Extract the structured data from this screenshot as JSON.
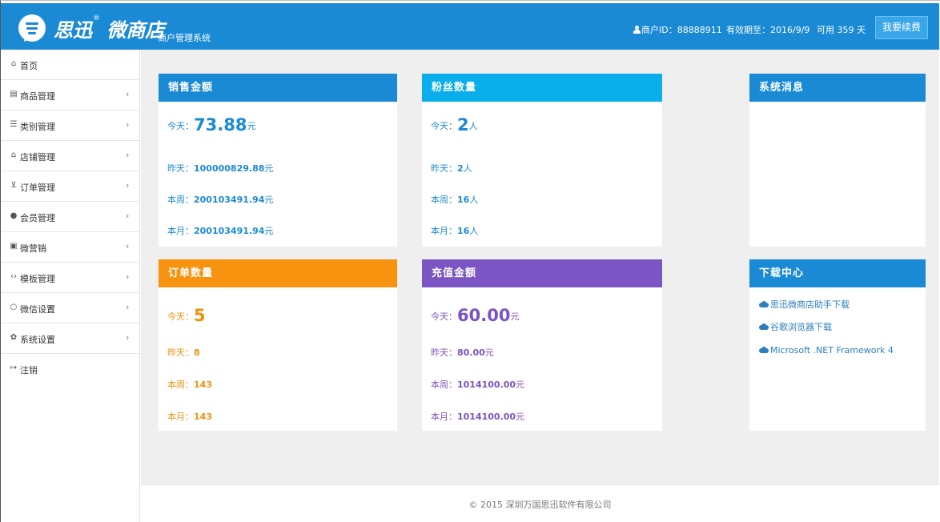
{
  "header": {
    "brand": "思迅",
    "brand_mark": "®",
    "brand_product": "微商店",
    "subtitle": "商户管理系统",
    "merchant_id_label": "商户ID：",
    "merchant_id": "88888911",
    "expiry_label": "有效期至：",
    "expiry": "2016/9/9",
    "days_label": "可用 359 天",
    "renew_button": "我要续费",
    "color": "#1a8ad5"
  },
  "sidebar": {
    "items": [
      {
        "icon": "home-icon",
        "label": "首页",
        "chevron": ""
      },
      {
        "icon": "list-alt-icon",
        "label": "商品管理",
        "chevron": "›"
      },
      {
        "icon": "list-icon",
        "label": "类别管理",
        "chevron": "›"
      },
      {
        "icon": "bank-icon",
        "label": "店铺管理",
        "chevron": "›"
      },
      {
        "icon": "cart-icon",
        "label": "订单管理",
        "chevron": "›"
      },
      {
        "icon": "user-icon",
        "label": "会员管理",
        "chevron": "›"
      },
      {
        "icon": "gift-icon",
        "label": "微营销",
        "chevron": "›"
      },
      {
        "icon": "code-icon",
        "label": "模板管理",
        "chevron": "›"
      },
      {
        "icon": "comment-icon",
        "label": "微信设置",
        "chevron": "›"
      },
      {
        "icon": "cogs-icon",
        "label": "系统设置",
        "chevron": "›"
      },
      {
        "icon": "sign-out-icon",
        "label": "注销",
        "chevron": ""
      }
    ]
  },
  "cards": {
    "sales": {
      "title": "销售金额",
      "color": "#1a8ad5",
      "today_label": "今天：",
      "today_value": "73.88",
      "today_unit": "元",
      "yesterday": "昨天：",
      "yesterday_value": "100000829.88",
      "yesterday_unit": "元",
      "week": "本周：",
      "week_value": "200103491.94",
      "week_unit": "元",
      "month": "本月：",
      "month_value": "200103491.94",
      "month_unit": "元"
    },
    "fans": {
      "title": "粉丝数量",
      "color": "#09aeea",
      "today_label": "今天：",
      "today_value": "2",
      "today_unit": "人",
      "yesterday": "昨天：",
      "yesterday_value": "2",
      "yesterday_unit": "人",
      "week": "本周：",
      "week_value": "16",
      "week_unit": "人",
      "month": "本月：",
      "month_value": "16",
      "month_unit": "人"
    },
    "orders": {
      "title": "订单数量",
      "color": "#f7930f",
      "today_label": "今天：",
      "today_value": "5",
      "yesterday": "昨天：",
      "yesterday_value": "8",
      "week": "本周：",
      "week_value": "143",
      "month": "本月：",
      "month_value": "143"
    },
    "recharge": {
      "title": "充值金额",
      "color": "#7b55c4",
      "today_label": "今天：",
      "today_value": "60.00",
      "today_unit": "元",
      "yesterday": "昨天：",
      "yesterday_value": "80.00",
      "yesterday_unit": "元",
      "week": "本周：",
      "week_value": "1014100.00",
      "week_unit": "元",
      "month": "本月：",
      "month_value": "1014100.00",
      "month_unit": "元"
    },
    "messages": {
      "title": "系统消息",
      "color": "#1a8ad5"
    },
    "downloads": {
      "title": "下载中心",
      "color": "#1a8ad5",
      "links": [
        "思迅微商店助手下载",
        "谷歌浏览器下载",
        "Microsoft .NET Framework 4"
      ]
    }
  },
  "footer": {
    "copyright": "© 2015 深圳万国思迅软件有限公司"
  }
}
